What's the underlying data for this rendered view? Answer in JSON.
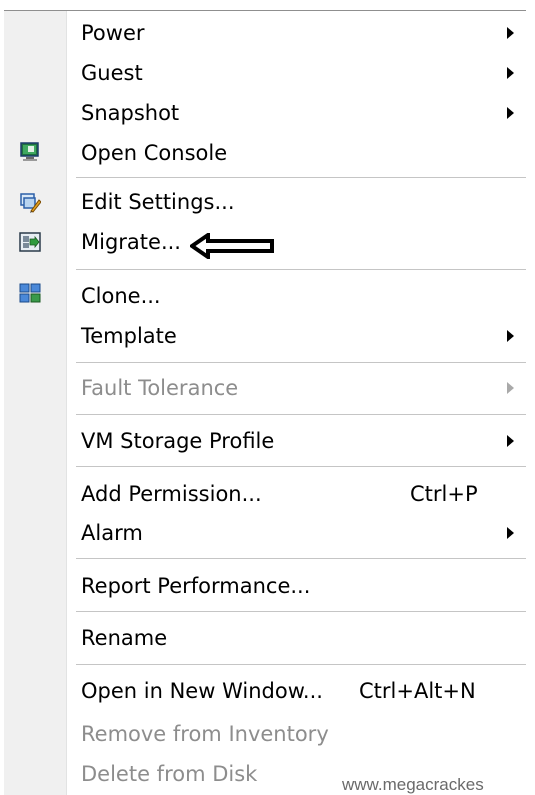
{
  "menu": {
    "items": [
      {
        "label": "Power",
        "submenu": true,
        "enabled": true
      },
      {
        "label": "Guest",
        "submenu": true,
        "enabled": true
      },
      {
        "label": "Snapshot",
        "submenu": true,
        "enabled": true
      },
      {
        "label": "Open Console",
        "icon": "console-icon",
        "enabled": true
      },
      {
        "label": "Edit Settings...",
        "icon": "edit-settings-icon",
        "enabled": true
      },
      {
        "label": "Migrate...",
        "icon": "migrate-icon",
        "enabled": true
      },
      {
        "label": "Clone...",
        "icon": "clone-icon",
        "enabled": true
      },
      {
        "label": "Template",
        "submenu": true,
        "enabled": true
      },
      {
        "label": "Fault Tolerance",
        "submenu": true,
        "enabled": false
      },
      {
        "label": "VM Storage Profile",
        "submenu": true,
        "enabled": true
      },
      {
        "label": "Add Permission...",
        "shortcut": "Ctrl+P",
        "enabled": true
      },
      {
        "label": "Alarm",
        "submenu": true,
        "enabled": true
      },
      {
        "label": "Report Performance...",
        "enabled": true
      },
      {
        "label": "Rename",
        "enabled": true
      },
      {
        "label": "Open in New Window...",
        "shortcut": "Ctrl+Alt+N",
        "enabled": true
      },
      {
        "label": "Remove from Inventory",
        "enabled": false
      },
      {
        "label": "Delete from Disk",
        "enabled": false
      }
    ]
  },
  "annotation": {
    "icon": "left-pointing-arrow-icon",
    "target": "Migrate..."
  },
  "watermark": "www.megacrackes",
  "colors": {
    "gutter": "#f0f0f0",
    "disabled_text": "#8d8d8d",
    "separator": "#c5c5c5"
  }
}
